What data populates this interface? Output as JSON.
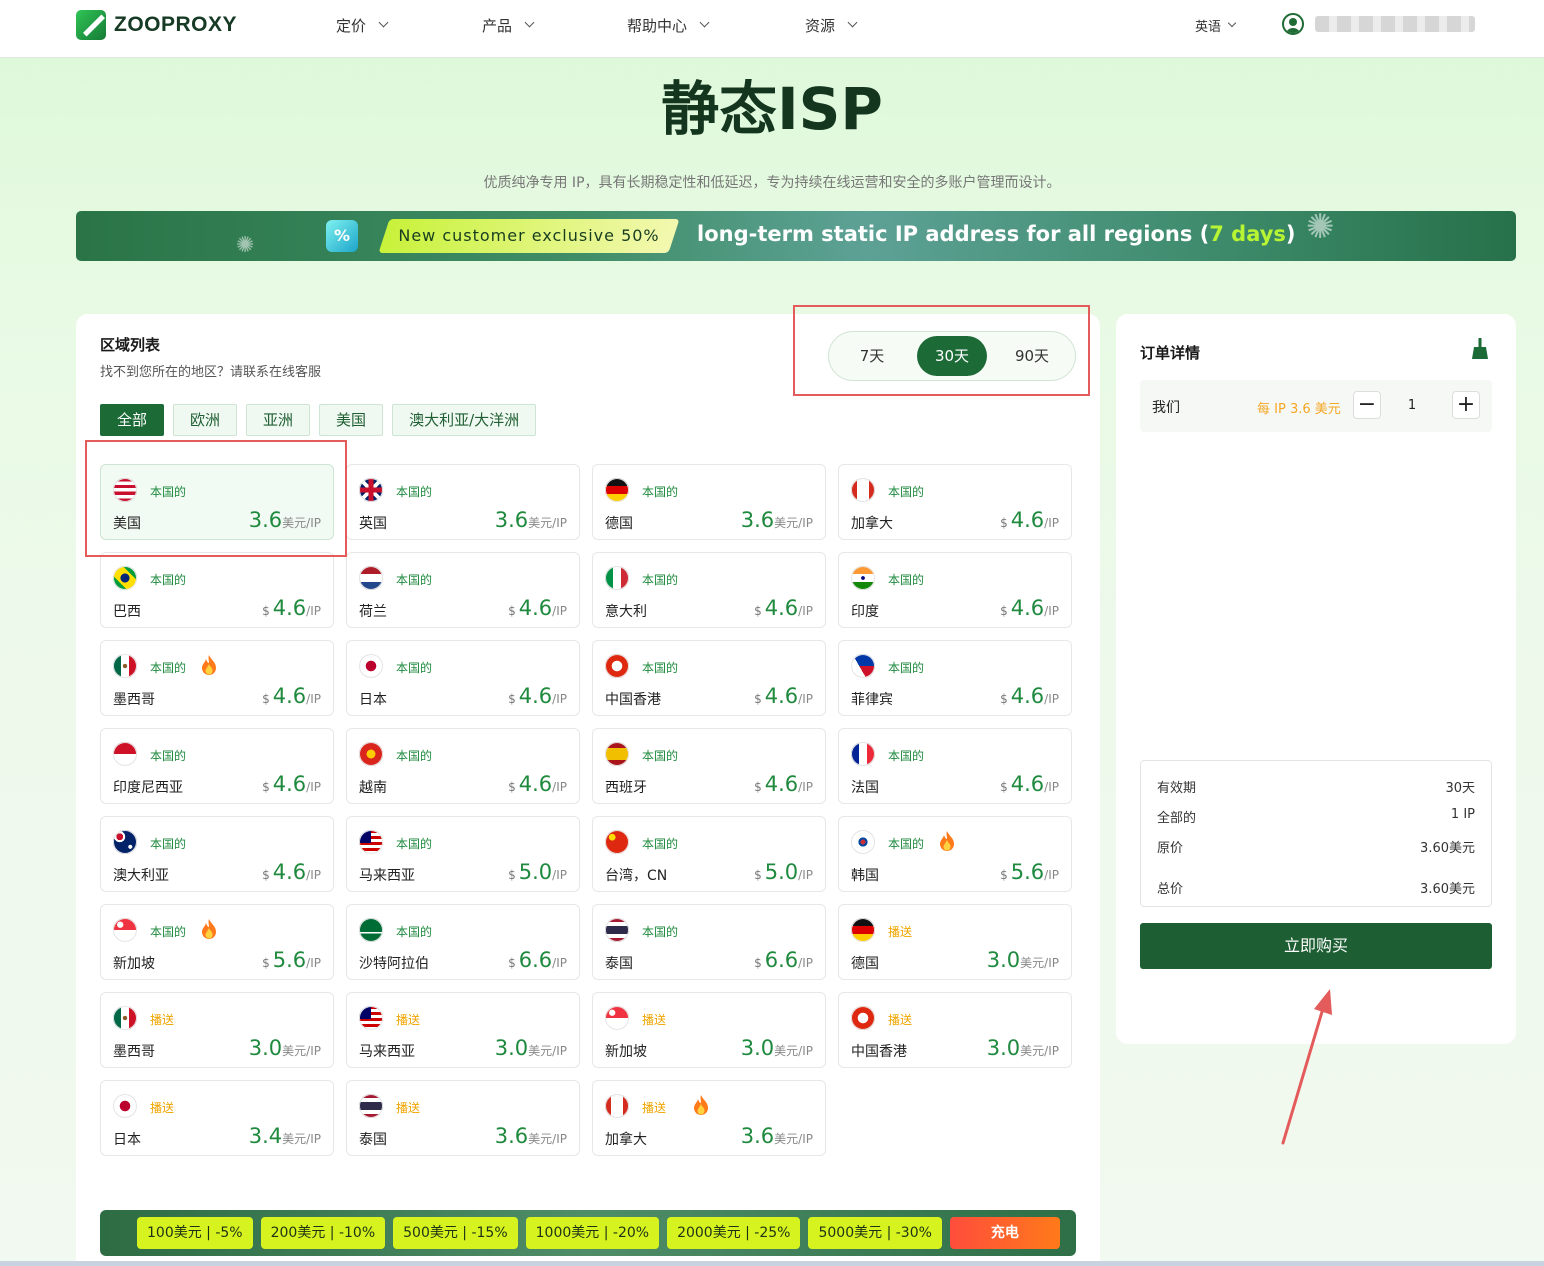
{
  "brand": {
    "name": "ZOOPROXY"
  },
  "nav": {
    "items": [
      {
        "label": "定价"
      },
      {
        "label": "产品"
      },
      {
        "label": "帮助中心"
      },
      {
        "label": "资源"
      }
    ],
    "language": "英语"
  },
  "hero": {
    "title": "静态ISP",
    "subtitle": "优质纯净专用 IP，具有长期稳定性和低延迟，专为持续在线运营和安全的多账户管理而设计。"
  },
  "promo": {
    "tag": "New customer exclusive 50%",
    "text_before": "long-term static IP address for all regions (",
    "days": "7 days",
    "text_after": ")"
  },
  "regions": {
    "title": "区域列表",
    "help": "找不到您所在的地区？请联系在线客服",
    "periods": [
      {
        "label": "7天",
        "active": false
      },
      {
        "label": "30天",
        "active": true
      },
      {
        "label": "90天",
        "active": false
      }
    ],
    "tabs": [
      {
        "label": "全部",
        "active": true
      },
      {
        "label": "欧洲",
        "active": false
      },
      {
        "label": "亚洲",
        "active": false
      },
      {
        "label": "美国",
        "active": false
      },
      {
        "label": "澳大利亚/大洋洲",
        "active": false
      }
    ],
    "cards": [
      {
        "flag": "us",
        "type": "本国的",
        "name": "美国",
        "currency": "",
        "price": "3.6",
        "unit": "美元/IP",
        "hot": false,
        "selected": true
      },
      {
        "flag": "gb",
        "type": "本国的",
        "name": "英国",
        "currency": "",
        "price": "3.6",
        "unit": "美元/IP",
        "hot": false
      },
      {
        "flag": "de",
        "type": "本国的",
        "name": "德国",
        "currency": "",
        "price": "3.6",
        "unit": "美元/IP",
        "hot": false
      },
      {
        "flag": "ca",
        "type": "本国的",
        "name": "加拿大",
        "currency": "$",
        "price": "4.6",
        "unit": "/IP",
        "hot": false
      },
      {
        "flag": "br",
        "type": "本国的",
        "name": "巴西",
        "currency": "$",
        "price": "4.6",
        "unit": "/IP",
        "hot": false
      },
      {
        "flag": "nl",
        "type": "本国的",
        "name": "荷兰",
        "currency": "$",
        "price": "4.6",
        "unit": "/IP",
        "hot": false
      },
      {
        "flag": "it",
        "type": "本国的",
        "name": "意大利",
        "currency": "$",
        "price": "4.6",
        "unit": "/IP",
        "hot": false
      },
      {
        "flag": "in",
        "type": "本国的",
        "name": "印度",
        "currency": "$",
        "price": "4.6",
        "unit": "/IP",
        "hot": false
      },
      {
        "flag": "mx",
        "type": "本国的",
        "name": "墨西哥",
        "currency": "$",
        "price": "4.6",
        "unit": "/IP",
        "hot": true
      },
      {
        "flag": "jp",
        "type": "本国的",
        "name": "日本",
        "currency": "$",
        "price": "4.6",
        "unit": "/IP",
        "hot": false
      },
      {
        "flag": "hk",
        "type": "本国的",
        "name": "中国香港",
        "currency": "$",
        "price": "4.6",
        "unit": "/IP",
        "hot": false
      },
      {
        "flag": "ph",
        "type": "本国的",
        "name": "菲律宾",
        "currency": "$",
        "price": "4.6",
        "unit": "/IP",
        "hot": false
      },
      {
        "flag": "id",
        "type": "本国的",
        "name": "印度尼西亚",
        "currency": "$",
        "price": "4.6",
        "unit": "/IP",
        "hot": false
      },
      {
        "flag": "vn",
        "type": "本国的",
        "name": "越南",
        "currency": "$",
        "price": "4.6",
        "unit": "/IP",
        "hot": false
      },
      {
        "flag": "es",
        "type": "本国的",
        "name": "西班牙",
        "currency": "$",
        "price": "4.6",
        "unit": "/IP",
        "hot": false
      },
      {
        "flag": "fr",
        "type": "本国的",
        "name": "法国",
        "currency": "$",
        "price": "4.6",
        "unit": "/IP",
        "hot": false
      },
      {
        "flag": "au",
        "type": "本国的",
        "name": "澳大利亚",
        "currency": "$",
        "price": "4.6",
        "unit": "/IP",
        "hot": false
      },
      {
        "flag": "my",
        "type": "本国的",
        "name": "马来西亚",
        "currency": "$",
        "price": "5.0",
        "unit": "/IP",
        "hot": false
      },
      {
        "flag": "cn",
        "type": "本国的",
        "name": "台湾，CN",
        "currency": "$",
        "price": "5.0",
        "unit": "/IP",
        "hot": false
      },
      {
        "flag": "kr",
        "type": "本国的",
        "name": "韩国",
        "currency": "$",
        "price": "5.6",
        "unit": "/IP",
        "hot": true
      },
      {
        "flag": "sg",
        "type": "本国的",
        "name": "新加坡",
        "currency": "$",
        "price": "5.6",
        "unit": "/IP",
        "hot": true
      },
      {
        "flag": "sa",
        "type": "本国的",
        "name": "沙特阿拉伯",
        "currency": "$",
        "price": "6.6",
        "unit": "/IP",
        "hot": false
      },
      {
        "flag": "th",
        "type": "本国的",
        "name": "泰国",
        "currency": "$",
        "price": "6.6",
        "unit": "/IP",
        "hot": false
      },
      {
        "flag": "de",
        "type": "播送",
        "name": "德国",
        "currency": "",
        "price": "3.0",
        "unit": "美元/IP",
        "hot": false
      },
      {
        "flag": "mx",
        "type": "播送",
        "name": "墨西哥",
        "currency": "",
        "price": "3.0",
        "unit": "美元/IP",
        "hot": false
      },
      {
        "flag": "my",
        "type": "播送",
        "name": "马来西亚",
        "currency": "",
        "price": "3.0",
        "unit": "美元/IP",
        "hot": false
      },
      {
        "flag": "sg",
        "type": "播送",
        "name": "新加坡",
        "currency": "",
        "price": "3.0",
        "unit": "美元/IP",
        "hot": false
      },
      {
        "flag": "hk",
        "type": "播送",
        "name": "中国香港",
        "currency": "",
        "price": "3.0",
        "unit": "美元/IP",
        "hot": false
      },
      {
        "flag": "jp",
        "type": "播送",
        "name": "日本",
        "currency": "",
        "price": "3.4",
        "unit": "美元/IP",
        "hot": false
      },
      {
        "flag": "th",
        "type": "播送",
        "name": "泰国",
        "currency": "",
        "price": "3.6",
        "unit": "美元/IP",
        "hot": false
      },
      {
        "flag": "ca",
        "type": "播送",
        "name": "加拿大",
        "currency": "",
        "price": "3.6",
        "unit": "美元/IP",
        "hot": true
      }
    ]
  },
  "discounts": {
    "tiers": [
      "100美元 | -5%",
      "200美元 | -10%",
      "500美元 | -15%",
      "1000美元 | -20%",
      "2000美元 | -25%",
      "5000美元 | -30%"
    ],
    "charge": "充电"
  },
  "order": {
    "title": "订单详情",
    "line": {
      "country": "我们",
      "per_ip": "每 IP 3.6 美元",
      "quantity": "1"
    },
    "summary": [
      {
        "label": "有效期",
        "value": "30天"
      },
      {
        "label": "全部的",
        "value": "1 IP"
      },
      {
        "label": "原价",
        "value": "3.60美元"
      },
      {
        "label": "总价",
        "value": "3.60美元"
      }
    ],
    "buy_label": "立即购买"
  },
  "colors": {
    "brand_green": "#1c6b37",
    "price_green": "#1f8a3e",
    "broadcast_orange": "#f0a500",
    "highlight_red": "#e45b5b"
  }
}
